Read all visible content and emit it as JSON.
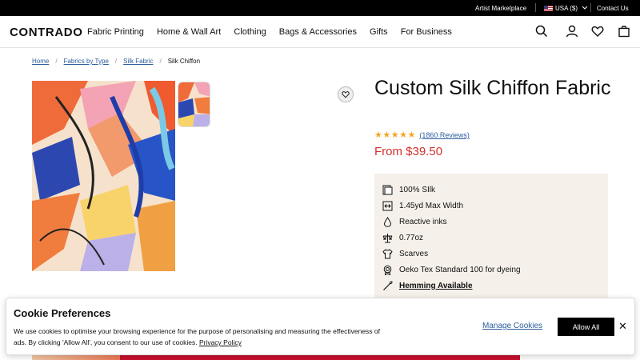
{
  "topbar": {
    "artist_marketplace": "Artist Marketplace",
    "region": "USA ($)",
    "contact": "Contact Us"
  },
  "header": {
    "logo": "CONTRADO",
    "nav": [
      "Fabric Printing",
      "Home & Wall Art",
      "Clothing",
      "Bags & Accessories",
      "Gifts",
      "For Business"
    ],
    "icons": [
      "search-icon",
      "account-icon",
      "wishlist-icon",
      "bag-icon"
    ]
  },
  "breadcrumb": [
    "Home",
    "Fabrics by Type",
    "Silk Fabric",
    "Silk Chiffon"
  ],
  "product": {
    "title": "Custom Silk Chiffon Fabric",
    "rating": 5,
    "reviews": "(1860 Reviews)",
    "price": "From $39.50",
    "features": [
      {
        "icon": "fabric-icon",
        "label": "100% SIlk"
      },
      {
        "icon": "width-icon",
        "label": "1.45yd Max Width"
      },
      {
        "icon": "ink-drop-icon",
        "label": "Reactive inks"
      },
      {
        "icon": "weight-scale-icon",
        "label": "0.77oz"
      },
      {
        "icon": "tshirt-icon",
        "label": "Scarves"
      },
      {
        "icon": "certificate-icon",
        "label": "Oeko Tex Standard 100 for dyeing"
      },
      {
        "icon": "needle-icon",
        "label": "Hemming Available"
      }
    ]
  },
  "cookie": {
    "title": "Cookie Preferences",
    "text": "We use cookies to optimise your browsing experience for the purpose of personalising and measuring the effectiveness of ads. By clicking 'Allow All', you consent to our use of cookies.",
    "policy_link": "Privacy Policy",
    "manage": "Manage Cookies",
    "allow": "Allow All",
    "close": "✕"
  },
  "colors": {
    "price_red": "#d0312d",
    "link_blue": "#2a5c9a",
    "star": "#f5a524",
    "panel_bg": "#f5f1ea"
  }
}
